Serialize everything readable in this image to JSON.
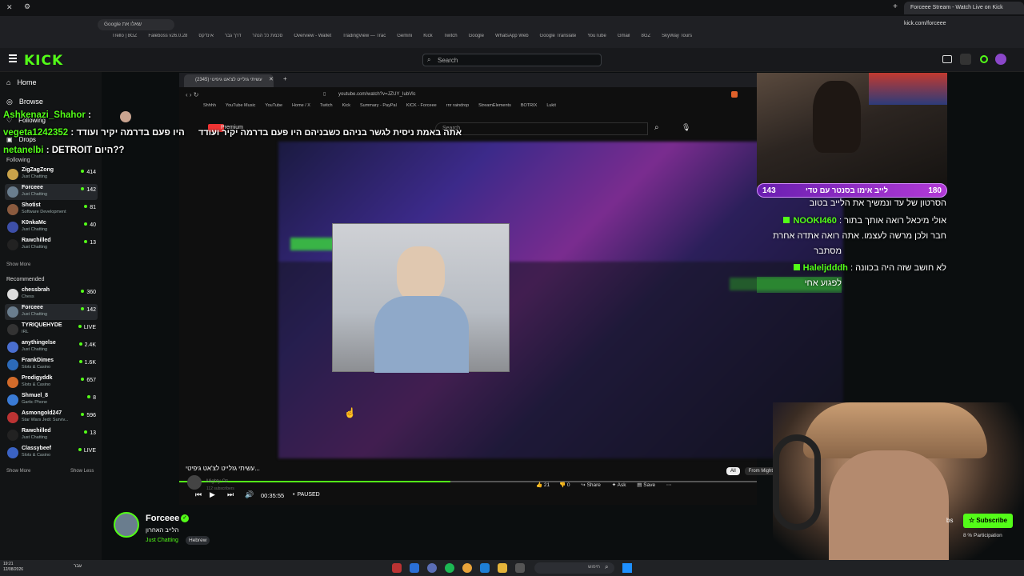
{
  "outer_browser": {
    "tab_title": "Forceee Stream - Watch Live on Kick",
    "url": "kick.com/forceee",
    "search_chip": "Google שאלו את",
    "bookmarks": [
      "Trello | 8GZ",
      "Faleboss v26.0.28",
      "סכמת כל הנהר",
      "דרך גבר",
      "אינדקס",
      "Overview - Wallet",
      "TradingView — Trac",
      "Gemini",
      "Kick",
      "Twitch",
      "Google",
      "WhatsApp Web",
      "Google Translate",
      "YouTube",
      "Gmail",
      "8GZ",
      "SkyWay Tours"
    ]
  },
  "kick": {
    "logo": "KICK",
    "search_placeholder": "Search",
    "nav": {
      "home": "Home",
      "browse": "Browse",
      "following": "Following",
      "drops": "Drops"
    },
    "following_header": "Following",
    "following": [
      {
        "name": "ZigZagZong",
        "cat": "Just Chatting",
        "viewers": "414",
        "color": "#c9a24a"
      },
      {
        "name": "Forceee",
        "cat": "Just Chatting",
        "viewers": "142",
        "color": "#6a7d8e"
      },
      {
        "name": "Shotist",
        "cat": "Software Development",
        "viewers": "81",
        "color": "#8a5a3e"
      },
      {
        "name": "K0nkaMc",
        "cat": "Just Chatting",
        "viewers": "40",
        "color": "#3d4fa8"
      },
      {
        "name": "Rawchilled",
        "cat": "Just Chatting",
        "viewers": "13",
        "color": "#222"
      }
    ],
    "show_more": "Show More",
    "recommended_header": "Recommended",
    "recommended": [
      {
        "name": "chessbrah",
        "cat": "Chess",
        "viewers": "360",
        "color": "#ddd"
      },
      {
        "name": "Forceee",
        "cat": "Just Chatting",
        "viewers": "142",
        "color": "#6a7d8e"
      },
      {
        "name": "TYRIQUEHYDE",
        "cat": "IRL",
        "viewers": "LIVE",
        "color": "#333"
      },
      {
        "name": "anythingelse",
        "cat": "Just Chatting",
        "viewers": "2.4K",
        "color": "#4a6fd0"
      },
      {
        "name": "FrankDimes",
        "cat": "Slots & Casino",
        "viewers": "1.6K",
        "color": "#2c6ab8"
      },
      {
        "name": "Prodigyddk",
        "cat": "Slots & Casino",
        "viewers": "657",
        "color": "#d26b2a"
      },
      {
        "name": "Shmuel_8",
        "cat": "Gartic Phone",
        "viewers": "8",
        "color": "#3a7bd5"
      },
      {
        "name": "Asmongold247",
        "cat": "Star Wars Jedi: Surviv...",
        "viewers": "596",
        "color": "#b33"
      },
      {
        "name": "Rawchilled",
        "cat": "Just Chatting",
        "viewers": "13",
        "color": "#222"
      },
      {
        "name": "Classybeef",
        "cat": "Slots & Casino",
        "viewers": "LIVE",
        "color": "#3b63c4"
      }
    ],
    "show_more2": "Show More",
    "show_less": "Show Less"
  },
  "overlay_chat": [
    {
      "user": "Ashkenazi_Shahor",
      "msg": ""
    },
    {
      "user": "vegeta1242352",
      "msg": ": היו פעם בדרמה יקיר ועודד"
    },
    {
      "user": "netanelbi",
      "msg": ": DETROIT היום??"
    }
  ],
  "inner_browser": {
    "tab_title": "עשיתי גזלייט לצ'אט גיפיטי (2345)",
    "url": "youtube.com/watch?v=JZUY_IubVlc",
    "bookmarks": [
      "Shhhh",
      "YouTube Music",
      "YouTube",
      "Home / X",
      "Twitch",
      "Kick",
      "Summary - PayPal",
      "KICK - Forceee",
      "rnr raindrop",
      "StreamElements",
      "BOTRIX",
      "Lukit"
    ],
    "yt_premium": "Premium",
    "yt_search": "Search",
    "subtitle": "אתה באמת ניסית לגשר בניהם כשבניהם היו פעם בדרמה יקיר ועודד",
    "video_title": "עשיתי גזלייט לצ'אט גיפיטי...",
    "channel": "Mighty Oz",
    "subs": "112 subscribers",
    "time": "00:35:55",
    "state": "PAUSED",
    "likes": "21",
    "dislikes": "0",
    "share": "Share",
    "ask": "Ask",
    "save": "Save",
    "chips": [
      "All",
      "From Mighty Oz",
      "Related",
      "For y"
    ]
  },
  "cam_chat": {
    "banner_count": "143",
    "banner_text": "לייב אימו בסנטר עם טדי",
    "banner_right": "180",
    "lines": [
      {
        "user": "",
        "msg": "הסרטון של עד ונמשיך את הלייב בטוב"
      },
      {
        "user": "NOOKI460",
        "msg": ": אולי מיכאל רואה אותך בתור"
      },
      {
        "user": "",
        "msg": "חבר ולכן מרשה לעצמו. אתה רואה אתדה אחרת"
      },
      {
        "user": "",
        "msg": "מסתבר"
      },
      {
        "user": "Haleljdddh",
        "msg": ": לא חושב שזה היה בכוונה"
      },
      {
        "user": "",
        "msg": "לפגוע אחי"
      }
    ]
  },
  "stream_info": {
    "name": "Forceee",
    "title": "הלייב האחרון",
    "category": "Just Chatting",
    "tag": "Hebrew",
    "subscribe": "Subscribe",
    "participation": "8 % Participation",
    "subs_partial": "bs"
  },
  "taskbar": {
    "time": "19:21",
    "date": "12/08/2026",
    "search": "חיפוש",
    "lang": "עבר"
  }
}
